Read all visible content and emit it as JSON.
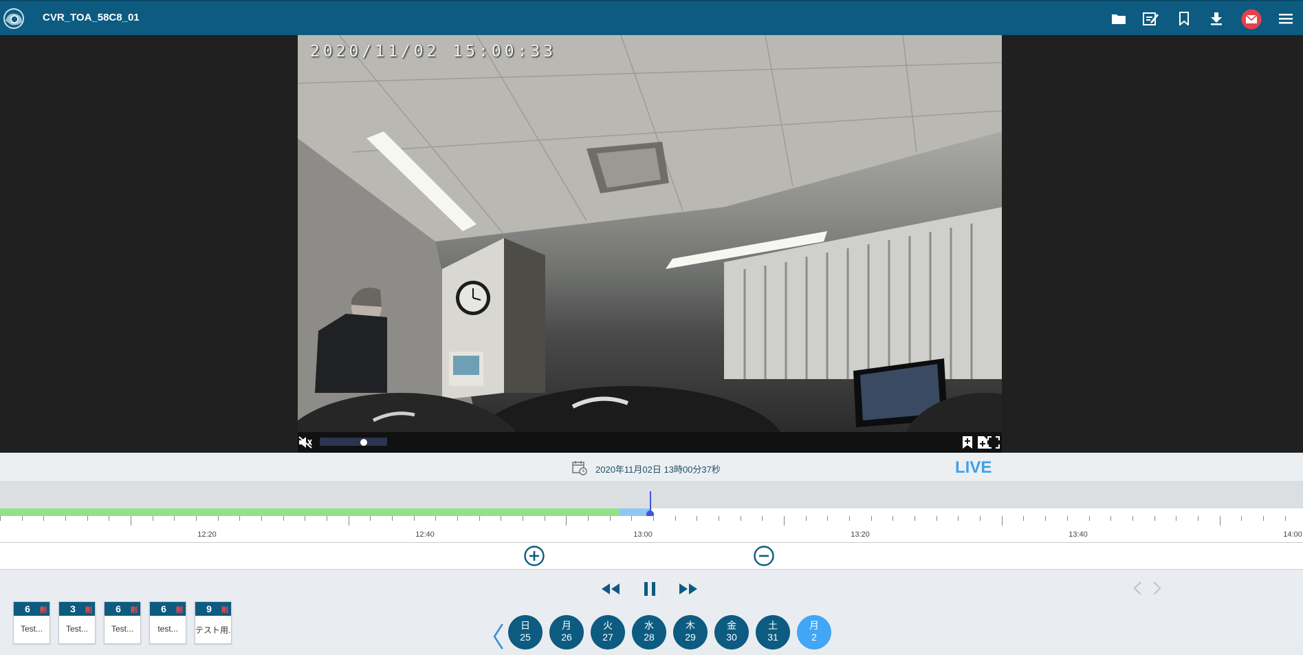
{
  "header": {
    "camera_name": "CVR_TOA_58C8_01",
    "icons": [
      "folder-icon",
      "edit-icon",
      "bookmark-icon",
      "download-icon",
      "mail-icon",
      "menu-icon"
    ]
  },
  "video": {
    "osd_timestamp": "2020/11/02  15:00:33",
    "volume_level": 0.65
  },
  "playback": {
    "current_datetime": "2020年11月02日 13時00分37秒",
    "live_label": "LIVE"
  },
  "timeline": {
    "tick_labels": [
      "12:20",
      "12:40",
      "13:00",
      "13:20",
      "13:40",
      "14:00"
    ]
  },
  "bookmarks": [
    {
      "count": "6",
      "delete": "削",
      "label": "Test..."
    },
    {
      "count": "3",
      "delete": "削",
      "label": "Test..."
    },
    {
      "count": "6",
      "delete": "削",
      "label": "Test..."
    },
    {
      "count": "6",
      "delete": "削",
      "label": "test..."
    },
    {
      "count": "9",
      "delete": "削",
      "label": "テスト用..."
    }
  ],
  "calendar": {
    "prev_symbol": "〈",
    "days": [
      {
        "weekday": "日",
        "date": "25"
      },
      {
        "weekday": "月",
        "date": "26"
      },
      {
        "weekday": "火",
        "date": "27"
      },
      {
        "weekday": "水",
        "date": "28"
      },
      {
        "weekday": "木",
        "date": "29"
      },
      {
        "weekday": "金",
        "date": "30"
      },
      {
        "weekday": "土",
        "date": "31"
      },
      {
        "weekday": "月",
        "date": "2"
      }
    ],
    "selected_date": "2"
  },
  "colors": {
    "header_bg": "#0d5b80",
    "recorded": "#8fe28a",
    "buffer": "#8ec8f2",
    "cursor": "#3f56d8",
    "live": "#3fa0e8",
    "selected_day": "#42a5f5"
  }
}
